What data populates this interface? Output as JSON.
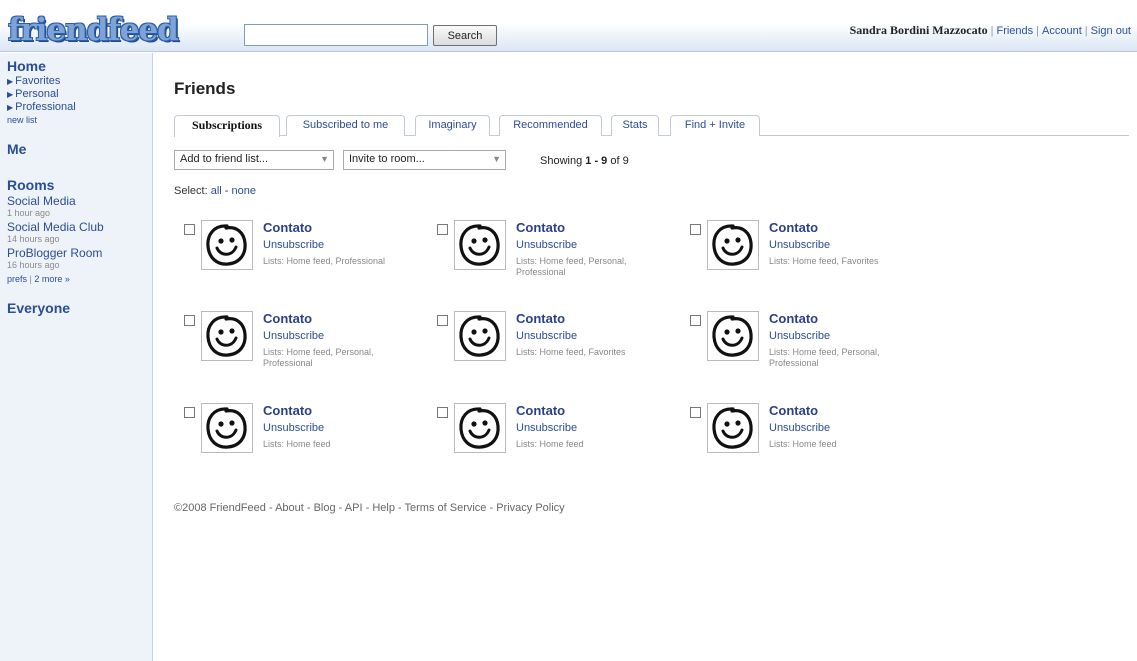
{
  "header": {
    "logo": "friendfeed",
    "search_value": "",
    "search_button": "Search",
    "user_name": "Sandra Bordini Mazzocato",
    "links": [
      "Friends",
      "Account",
      "Sign out"
    ],
    "separator": "|"
  },
  "sidebar": {
    "home": "Home",
    "lists": [
      "Favorites",
      "Personal",
      "Professional"
    ],
    "new_list": "new list",
    "me": "Me",
    "rooms_title": "Rooms",
    "rooms": [
      {
        "name": "Social Media",
        "time": "1 hour ago"
      },
      {
        "name": "Social Media Club",
        "time": "14 hours ago"
      },
      {
        "name": "ProBlogger Room",
        "time": "16 hours ago"
      }
    ],
    "prefs": "prefs",
    "more": "2 more »",
    "everyone": "Everyone"
  },
  "main": {
    "title": "Friends",
    "tabs": [
      "Subscriptions",
      "Subscribed to me",
      "Imaginary",
      "Recommended",
      "Stats",
      "Find + Invite"
    ],
    "add_to_list": "Add to friend list...",
    "invite_to_room": "Invite to room...",
    "showing_prefix": "Showing ",
    "showing_range": "1 - 9",
    "showing_suffix": " of 9",
    "select_label": "Select:",
    "select_all": "all",
    "select_dash": "-",
    "select_none": "none",
    "friends": [
      {
        "name": "Contato",
        "action": "Unsubscribe",
        "lists": "Lists: Home feed, Professional"
      },
      {
        "name": "Contato",
        "action": "Unsubscribe",
        "lists": "Lists: Home feed, Personal, Professional"
      },
      {
        "name": "Contato",
        "action": "Unsubscribe",
        "lists": "Lists: Home feed, Favorites"
      },
      {
        "name": "Contato",
        "action": "Unsubscribe",
        "lists": "Lists: Home feed, Personal, Professional"
      },
      {
        "name": "Contato",
        "action": "Unsubscribe",
        "lists": "Lists: Home feed, Favorites"
      },
      {
        "name": "Contato",
        "action": "Unsubscribe",
        "lists": "Lists: Home feed, Personal, Professional"
      },
      {
        "name": "Contato",
        "action": "Unsubscribe",
        "lists": "Lists: Home feed"
      },
      {
        "name": "Contato",
        "action": "Unsubscribe",
        "lists": "Lists: Home feed"
      },
      {
        "name": "Contato",
        "action": "Unsubscribe",
        "lists": "Lists: Home feed"
      }
    ]
  },
  "footer": {
    "copyright": "©2008 FriendFeed",
    "links": [
      "About",
      "Blog",
      "API",
      "Help",
      "Terms of Service",
      "Privacy Policy"
    ]
  },
  "colors": {
    "link": "#2b4d96",
    "sidebar_bg": "#eef3fa",
    "logo": "#7fa3d7"
  },
  "icons": {
    "avatar": "smiley-avatar-icon",
    "list_arrow": "triangle-right-icon",
    "dropdown": "chevron-down-icon"
  }
}
